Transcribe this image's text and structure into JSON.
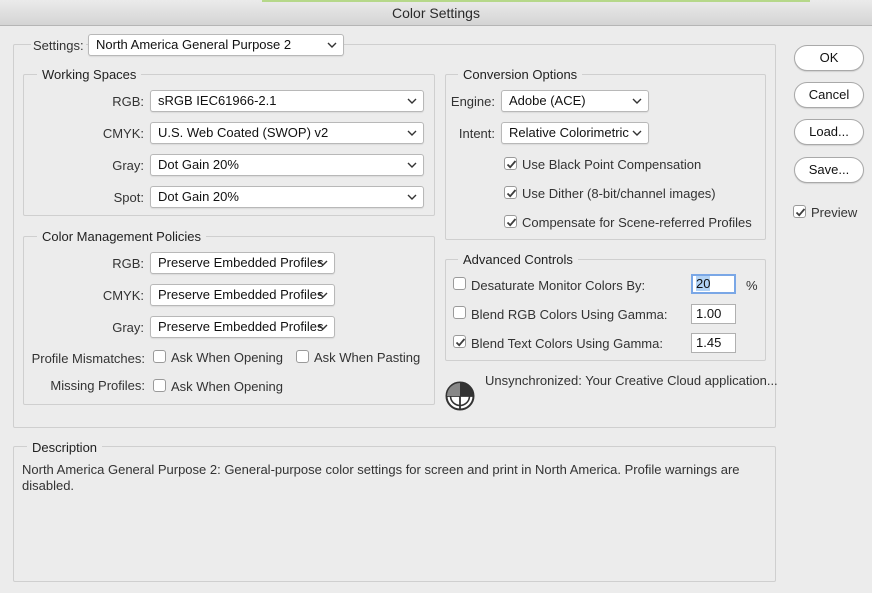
{
  "window": {
    "title": "Color Settings"
  },
  "settings": {
    "label": "Settings:",
    "value": "North America General Purpose 2"
  },
  "working_spaces": {
    "title": "Working Spaces",
    "rgb": {
      "label": "RGB:",
      "value": "sRGB IEC61966-2.1"
    },
    "cmyk": {
      "label": "CMYK:",
      "value": "U.S. Web Coated (SWOP) v2"
    },
    "gray": {
      "label": "Gray:",
      "value": "Dot Gain 20%"
    },
    "spot": {
      "label": "Spot:",
      "value": "Dot Gain 20%"
    }
  },
  "policies": {
    "title": "Color Management Policies",
    "rgb": {
      "label": "RGB:",
      "value": "Preserve Embedded Profiles"
    },
    "cmyk": {
      "label": "CMYK:",
      "value": "Preserve Embedded Profiles"
    },
    "gray": {
      "label": "Gray:",
      "value": "Preserve Embedded Profiles"
    },
    "mismatches": {
      "label": "Profile Mismatches:",
      "ask_opening": "Ask When Opening",
      "ask_pasting": "Ask When Pasting",
      "ask_opening_checked": false,
      "ask_pasting_checked": false
    },
    "missing": {
      "label": "Missing Profiles:",
      "ask_opening": "Ask When Opening",
      "ask_opening_checked": false
    }
  },
  "conversion": {
    "title": "Conversion Options",
    "engine": {
      "label": "Engine:",
      "value": "Adobe (ACE)"
    },
    "intent": {
      "label": "Intent:",
      "value": "Relative Colorimetric"
    },
    "black_point": {
      "label": "Use Black Point Compensation",
      "checked": true
    },
    "dither": {
      "label": "Use Dither (8-bit/channel images)",
      "checked": true
    },
    "scene": {
      "label": "Compensate for Scene-referred Profiles",
      "checked": true
    }
  },
  "advanced": {
    "title": "Advanced Controls",
    "desaturate": {
      "label": "Desaturate Monitor Colors By:",
      "value": "20",
      "unit": "%",
      "checked": false
    },
    "blend_rgb": {
      "label": "Blend RGB Colors Using Gamma:",
      "value": "1.00",
      "checked": false
    },
    "blend_text": {
      "label": "Blend Text Colors Using Gamma:",
      "value": "1.45",
      "checked": true
    }
  },
  "sync": {
    "status": "Unsynchronized: Your Creative Cloud application..."
  },
  "description": {
    "title": "Description",
    "text": "North America General Purpose 2:  General-purpose color settings for screen and print in North America. Profile warnings are disabled."
  },
  "buttons": {
    "ok": "OK",
    "cancel": "Cancel",
    "load": "Load...",
    "save": "Save..."
  },
  "preview": {
    "label": "Preview",
    "checked": true
  },
  "colors": {
    "checkmark": "#3d3d3d",
    "focus_ring": "#7aa7e6",
    "selection": "#b3d3f5"
  }
}
